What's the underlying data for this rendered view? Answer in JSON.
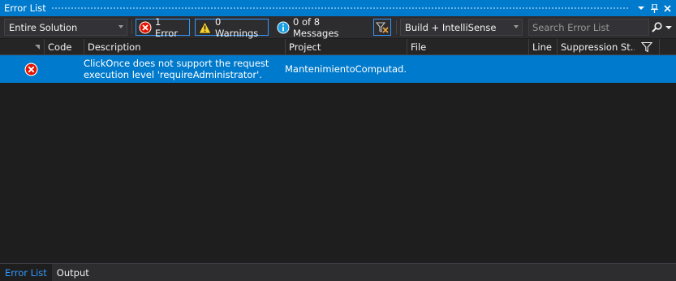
{
  "window": {
    "title": "Error List",
    "pin_glyph": "▾",
    "close_glyph": "✕"
  },
  "toolbar": {
    "scope_combo": {
      "selected": "Entire Solution"
    },
    "errors_filter": {
      "label": "1 Error",
      "icon": "error-circle-icon"
    },
    "warnings_filter": {
      "label": "0 Warnings",
      "icon": "warning-triangle-icon"
    },
    "messages_filter": {
      "label": "0 of 8 Messages",
      "icon": "info-circle-icon"
    },
    "clear_filter_icon": "clear-filter-icon",
    "build_combo": {
      "selected": "Build + IntelliSense"
    },
    "search": {
      "placeholder": "Search Error List"
    }
  },
  "grid": {
    "columns": [
      {
        "key": "sort",
        "label": ""
      },
      {
        "key": "code",
        "label": "Code"
      },
      {
        "key": "description",
        "label": "Description"
      },
      {
        "key": "project",
        "label": "Project"
      },
      {
        "key": "file",
        "label": "File"
      },
      {
        "key": "line",
        "label": "Line"
      },
      {
        "key": "suppression",
        "label": "Suppression St..."
      }
    ],
    "rows": [
      {
        "severity_icon": "error-circle-icon",
        "code": "",
        "description": "ClickOnce does not support the request execution level 'requireAdministrator'.",
        "project": "MantenimientoComputad...",
        "file": "",
        "line": "",
        "suppression": "",
        "selected": true
      }
    ]
  },
  "bottom_tabs": [
    {
      "label": "Error List",
      "active": true
    },
    {
      "label": "Output",
      "active": false
    }
  ],
  "colors": {
    "accent": "#007acc",
    "background": "#1e1e1e",
    "toolbar": "#2d2d30",
    "error_red": "#e51400",
    "warning_yellow": "#f8d22c",
    "info_blue": "#1ba1e2"
  }
}
